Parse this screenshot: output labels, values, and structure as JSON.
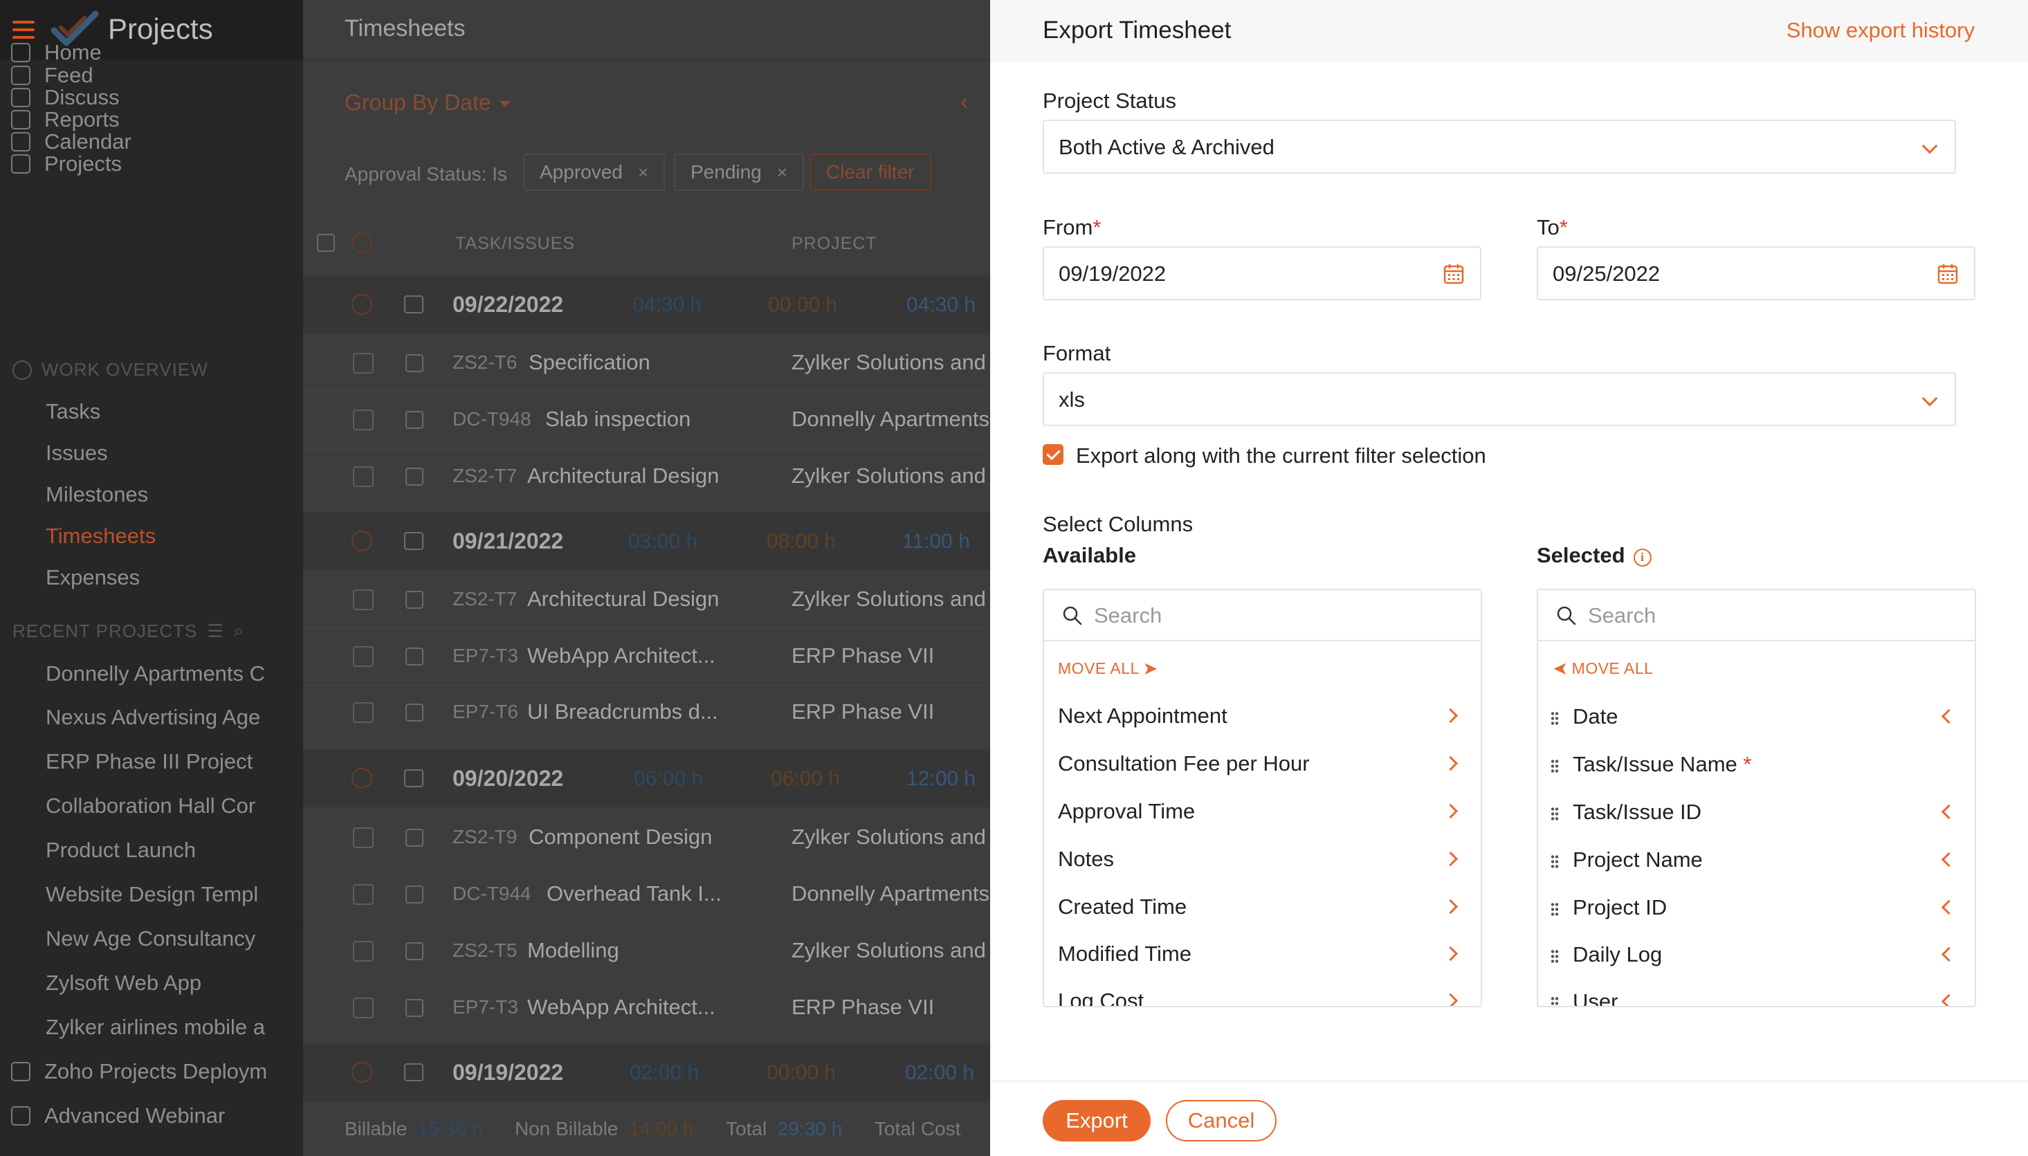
{
  "sidebar": {
    "app_title": "Projects",
    "nav": [
      "Home",
      "Feed",
      "Discuss",
      "Reports",
      "Calendar",
      "Projects"
    ],
    "work_overview_title": "WORK OVERVIEW",
    "work_overview": [
      "Tasks",
      "Issues",
      "Milestones",
      "Timesheets",
      "Expenses"
    ],
    "recent_title": "RECENT PROJECTS",
    "recent": [
      "Donnelly Apartments C",
      "Nexus Advertising Age",
      "ERP Phase III Project",
      "Collaboration Hall Cor",
      "Product Launch",
      "Website Design Templ",
      "New Age Consultancy",
      "Zylsoft Web App",
      "Zylker airlines mobile a"
    ],
    "bottom": [
      "Zoho Projects Deploym",
      "Advanced Webinar"
    ]
  },
  "main": {
    "title": "Timesheets",
    "group_by": "Group By Date",
    "filter_label": "Approval Status: Is",
    "chip_approved": "Approved",
    "chip_pending": "Pending",
    "clear_filter": "Clear filter",
    "col_task": "TASK/ISSUES",
    "col_project": "PROJECT",
    "dates": [
      {
        "date": "09/22/2022",
        "billable": "04:30",
        "non_billable": "00:00",
        "total": "04:30"
      },
      {
        "date": "09/21/2022",
        "billable": "03:00",
        "non_billable": "08:00",
        "total": "11:00"
      },
      {
        "date": "09/20/2022",
        "billable": "06:00",
        "non_billable": "06:00",
        "total": "12:00"
      },
      {
        "date": "09/19/2022",
        "billable": "02:00",
        "non_billable": "00:00",
        "total": "02:00"
      }
    ],
    "hour_unit": "h",
    "tasks": [
      {
        "id": "ZS2-T6",
        "name": "Specification",
        "project": "Zylker Solutions and"
      },
      {
        "id": "DC-T948",
        "name": "Slab inspection",
        "project": "Donnelly Apartments"
      },
      {
        "id": "ZS2-T7",
        "name": "Architectural Design",
        "project": "Zylker Solutions and"
      },
      {
        "id": "ZS2-T7",
        "name": "Architectural Design",
        "project": "Zylker Solutions and"
      },
      {
        "id": "EP7-T3",
        "name": "WebApp Architect...",
        "project": "ERP Phase VII"
      },
      {
        "id": "EP7-T6",
        "name": "UI Breadcrumbs d...",
        "project": "ERP Phase VII"
      },
      {
        "id": "ZS2-T9",
        "name": "Component Design",
        "project": "Zylker Solutions and"
      },
      {
        "id": "DC-T944",
        "name": "Overhead Tank I...",
        "project": "Donnelly Apartments"
      },
      {
        "id": "ZS2-T5",
        "name": "Modelling",
        "project": "Zylker Solutions and"
      },
      {
        "id": "EP7-T3",
        "name": "WebApp Architect...",
        "project": "ERP Phase VII"
      }
    ],
    "footer": {
      "billable_label": "Billable",
      "billable": "15:30 h",
      "non_billable_label": "Non Billable",
      "non_billable": "14:00 h",
      "total_label": "Total",
      "total": "29:30 h",
      "total_cost_label": "Total Cost"
    }
  },
  "panel": {
    "title": "Export Timesheet",
    "history_link": "Show export history",
    "project_status_label": "Project Status",
    "project_status_value": "Both Active & Archived",
    "from_label": "From",
    "from_value": "09/19/2022",
    "to_label": "To",
    "to_value": "09/25/2022",
    "required_mark": "*",
    "format_label": "Format",
    "format_value": "xls",
    "export_filter_label": "Export along with the current filter selection",
    "export_filter_checked": true,
    "select_columns_label": "Select Columns",
    "available_label": "Available",
    "selected_label": "Selected",
    "search_placeholder": "Search",
    "move_all_right": "MOVE ALL",
    "move_all_left": "MOVE ALL",
    "available_items": [
      "Next Appointment",
      "Consultation Fee per Hour",
      "Approval Time",
      "Notes",
      "Created Time",
      "Modified Time",
      "Log Cost"
    ],
    "selected_items": [
      {
        "name": "Date",
        "required": false
      },
      {
        "name": "Task/Issue Name",
        "required": true
      },
      {
        "name": "Task/Issue ID",
        "required": false
      },
      {
        "name": "Project Name",
        "required": false
      },
      {
        "name": "Project ID",
        "required": false
      },
      {
        "name": "Daily Log",
        "required": false
      },
      {
        "name": "User",
        "required": false
      }
    ],
    "export_button": "Export",
    "cancel_button": "Cancel"
  },
  "colors": {
    "accent": "#e8692b",
    "required": "#e03c2d",
    "sidebar_bg": "#272727",
    "overlay_bg": "#3d3d3d"
  }
}
